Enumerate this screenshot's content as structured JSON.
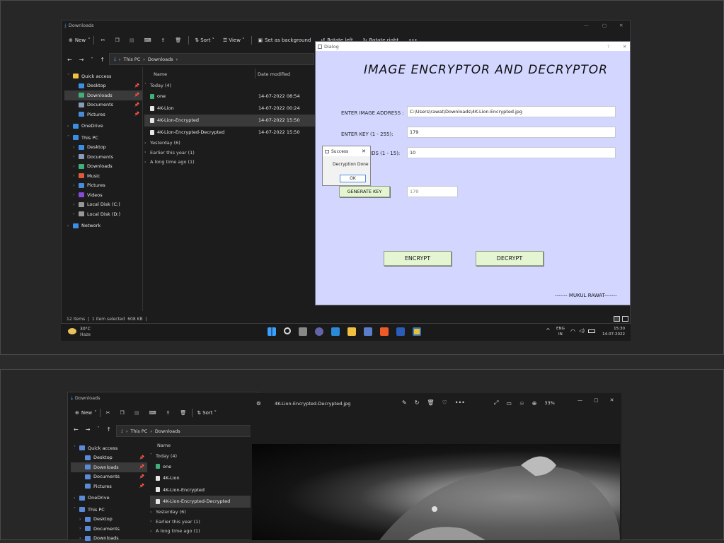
{
  "top": {
    "explorer": {
      "title": "Downloads",
      "toolbar": {
        "new": "New",
        "sort": "Sort",
        "view": "View",
        "set_bg": "Set as background",
        "rotate_left": "Rotate left",
        "rotate_right": "Rotate right",
        "more": "•••"
      },
      "path": [
        "This PC",
        "Downloads"
      ],
      "sidebar": [
        {
          "label": "Quick access",
          "kind": "header",
          "icon": "star-icon"
        },
        {
          "label": "Desktop",
          "pin": true,
          "icon": "desktop-icon"
        },
        {
          "label": "Downloads",
          "pin": true,
          "selected": true,
          "icon": "download-icon"
        },
        {
          "label": "Documents",
          "pin": true,
          "icon": "documents-icon"
        },
        {
          "label": "Pictures",
          "pin": true,
          "icon": "pictures-icon"
        },
        {
          "label": "OneDrive",
          "kind": "header",
          "icon": "cloud-icon"
        },
        {
          "label": "This PC",
          "kind": "header",
          "icon": "pc-icon"
        },
        {
          "label": "Desktop",
          "icon": "desktop-icon"
        },
        {
          "label": "Documents",
          "icon": "documents-icon"
        },
        {
          "label": "Downloads",
          "icon": "download-icon"
        },
        {
          "label": "Music",
          "icon": "music-icon"
        },
        {
          "label": "Pictures",
          "icon": "pictures-icon"
        },
        {
          "label": "Videos",
          "icon": "videos-icon"
        },
        {
          "label": "Local Disk (C:)",
          "icon": "disk-icon"
        },
        {
          "label": "Local Disk (D:)",
          "icon": "disk-icon"
        },
        {
          "label": "Network",
          "kind": "header",
          "icon": "network-icon"
        }
      ],
      "columns": {
        "name": "Name",
        "date": "Date modified"
      },
      "groups": [
        {
          "label": "Today (4)",
          "files": [
            {
              "name": "one",
              "date": "14-07-2022 08:54"
            },
            {
              "name": "4K-Lion",
              "date": "14-07-2022 00:24"
            },
            {
              "name": "4K-Lion-Encrypted",
              "date": "14-07-2022 15:50",
              "selected": true
            },
            {
              "name": "4K-Lion-Encrypted-Decrypted",
              "date": "14-07-2022 15:50"
            }
          ]
        },
        {
          "label": "Yesterday (6)"
        },
        {
          "label": "Earlier this year (1)"
        },
        {
          "label": "A long time ago (1)"
        }
      ],
      "status": "12 items  |  1 item selected  608 KB  |"
    },
    "dialog": {
      "title": "Dialog",
      "heading": "IMAGE ENCRYPTOR AND DECRYPTOR",
      "image_label": "ENTER IMAGE ADDRESS :",
      "image_value": "C:\\Users\\rawat\\Downloads\\4K-Lion-Encrypted.jpg",
      "key_label": "ENTER KEY (1 - 255):",
      "key_value": "179",
      "rounds_label": "IDS (1 - 15):",
      "rounds_value": "10",
      "generate_label": "GENERATE KEY",
      "generated_value": "179",
      "encrypt_label": "ENCRYPT",
      "decrypt_label": "DECRYPT",
      "credit": "------- MUKUL RAWAT-------",
      "help": "?",
      "close": "✕"
    },
    "msgbox": {
      "title": "Success",
      "message": "Decryption Done",
      "ok": "OK",
      "close": "✕"
    },
    "taskbar": {
      "temp": "30°C",
      "weather": "Haze",
      "lang1": "ENG",
      "lang2": "IN",
      "time": "15:30",
      "date": "14-07-2022"
    }
  },
  "bottom": {
    "explorer": {
      "title": "Downloads",
      "toolbar": {
        "new": "New",
        "sort": "Sort"
      },
      "path": [
        "This PC",
        "Downloads"
      ],
      "sidebar": [
        {
          "label": "Quick access",
          "kind": "header"
        },
        {
          "label": "Desktop",
          "pin": true
        },
        {
          "label": "Downloads",
          "pin": true,
          "selected": true
        },
        {
          "label": "Documents",
          "pin": true
        },
        {
          "label": "Pictures",
          "pin": true
        },
        {
          "label": "OneDrive",
          "kind": "header"
        },
        {
          "label": "This PC",
          "kind": "header"
        },
        {
          "label": "Desktop"
        },
        {
          "label": "Documents"
        },
        {
          "label": "Downloads"
        }
      ],
      "column_name": "Name",
      "groups": [
        "Today (4)",
        "one",
        "4K-Lion",
        "4K-Lion-Encrypted",
        "4K-Lion-Encrypted-Decrypted",
        "Yesterday (6)",
        "Earlier this year (1)",
        "A long time ago (1)"
      ]
    },
    "photos": {
      "filename": "4K-Lion-Encrypted-Decrypted.jpg",
      "zoom": "33%",
      "more": "•••"
    }
  },
  "colors": {
    "dialog_bg": "#d3d7ff",
    "button_bg": "#e4f5d2",
    "explorer_bg": "#1c1c1c",
    "accent": "#4a90e2"
  }
}
